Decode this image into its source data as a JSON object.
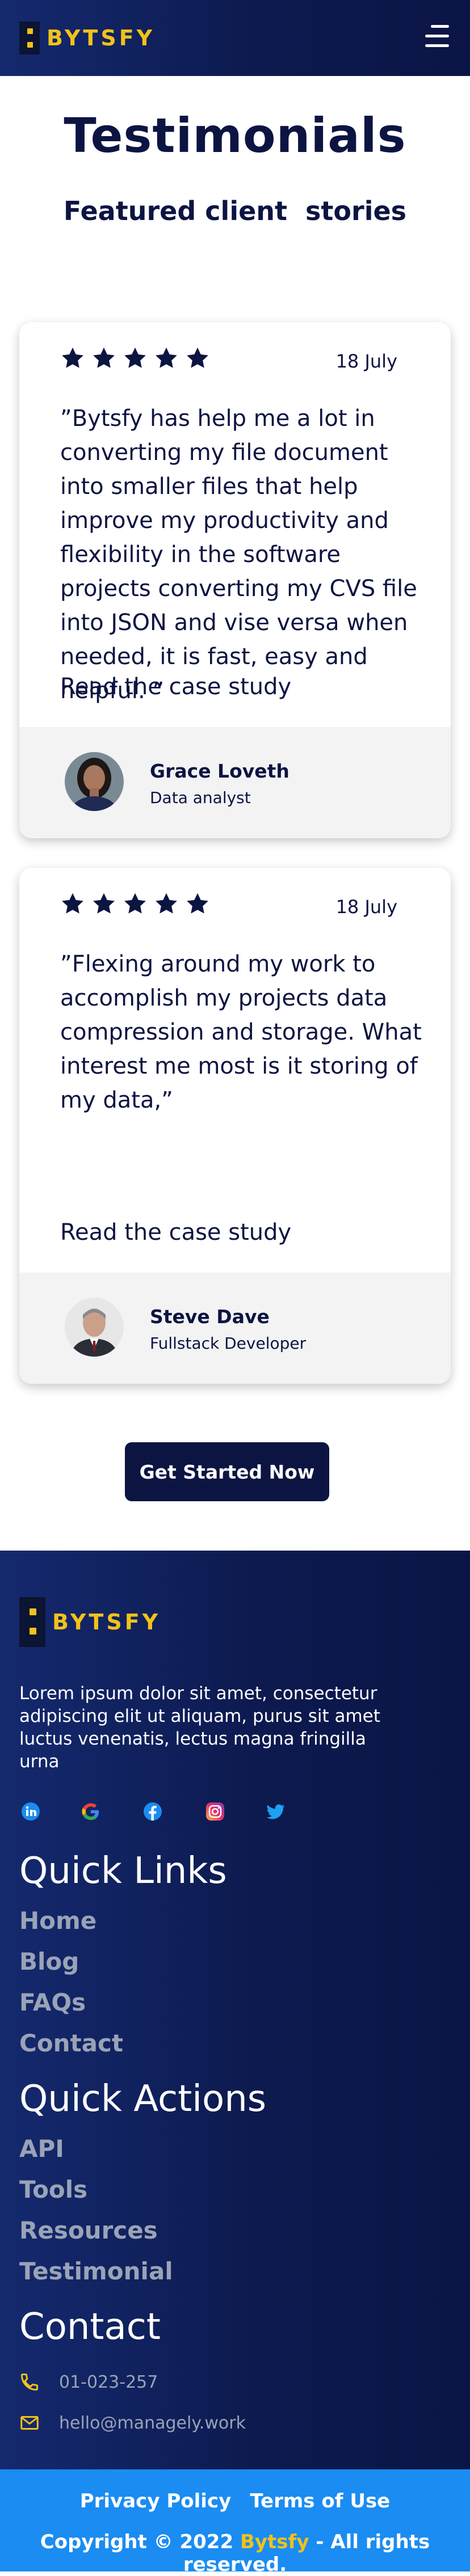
{
  "header": {
    "brand": "BYTSFY",
    "menu_icon": "hamburger-menu-icon"
  },
  "hero": {
    "title": "Testimonials",
    "subtitle": "Featured client  stories"
  },
  "testimonials": [
    {
      "rating": 5,
      "date": "18 July",
      "quote": "”Bytsfy has help me a lot in converting my file document into smaller files that help improve my productivity and flexibility in the software projects converting my CVS file into JSON and vise versa when needed, it is fast, easy and helpful. ”",
      "case_link": "Read the case study",
      "author_name": "Grace Loveth",
      "author_role": "Data analyst"
    },
    {
      "rating": 5,
      "date": "18 July",
      "quote": "”Flexing around my work to accomplish my projects data compression and storage. What interest me most is it storing of my data,”",
      "case_link": "Read the case study",
      "author_name": "Steve Dave",
      "author_role": "Fullstack Developer"
    }
  ],
  "cta": {
    "label": "Get Started Now"
  },
  "footer": {
    "brand": "BYTSFY",
    "description": "Lorem ipsum dolor sit amet, consectetur adipiscing elit ut aliquam, purus sit amet luctus venenatis, lectus magna fringilla urna",
    "social": [
      "linkedin-icon",
      "google-icon",
      "facebook-icon",
      "instagram-icon",
      "twitter-icon"
    ],
    "quick_links": {
      "heading": "Quick Links",
      "items": [
        "Home",
        "Blog",
        "FAQs",
        "Contact"
      ]
    },
    "quick_actions": {
      "heading": "Quick Actions",
      "items": [
        "API",
        "Tools",
        "Resources",
        "Testimonial"
      ]
    },
    "contact": {
      "heading": "Contact",
      "phone": "01-023-257",
      "email": "hello@managely.work"
    },
    "legal": {
      "privacy": "Privacy Policy",
      "terms": "Terms of Use",
      "copyright_prefix": "Copyright © 2022",
      "copyright_brand": "Bytsfy",
      "copyright_suffix": "- All rights reserved."
    }
  },
  "colors": {
    "navy": "#0c1442",
    "brand_yellow": "#f2c218",
    "footer_bar_blue": "#1a8cf2",
    "muted_link": "#9aa3b6"
  }
}
